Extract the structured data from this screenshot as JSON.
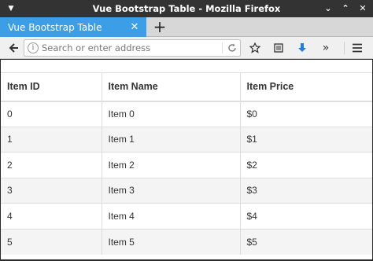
{
  "window": {
    "title": "Vue Bootstrap Table - Mozilla Firefox"
  },
  "tabs": [
    {
      "label": "Vue Bootstrap Table",
      "active": true
    }
  ],
  "navbar": {
    "url_placeholder": "Search or enter address",
    "url_value": ""
  },
  "icons": {
    "menu": "menu-down-icon",
    "minimize": "minimize-icon",
    "maximize": "maximize-icon",
    "close": "close-icon",
    "back": "back-arrow-icon",
    "info": "info-icon",
    "reload": "reload-icon",
    "bookmark": "star-icon",
    "reader": "reading-list-icon",
    "download": "download-arrow-icon",
    "overflow": "overflow-chevrons-icon",
    "app_menu": "hamburger-menu-icon"
  },
  "colors": {
    "titlebar": "#333333",
    "active_tab": "#3d9ee8",
    "download_icon": "#1a7fe0",
    "stripe": "#f4f4f4"
  },
  "table": {
    "headers": [
      "Item ID",
      "Item Name",
      "Item Price"
    ],
    "rows": [
      [
        "0",
        "Item 0",
        "$0"
      ],
      [
        "1",
        "Item 1",
        "$1"
      ],
      [
        "2",
        "Item 2",
        "$2"
      ],
      [
        "3",
        "Item 3",
        "$3"
      ],
      [
        "4",
        "Item 4",
        "$4"
      ],
      [
        "5",
        "Item 5",
        "$5"
      ]
    ]
  }
}
